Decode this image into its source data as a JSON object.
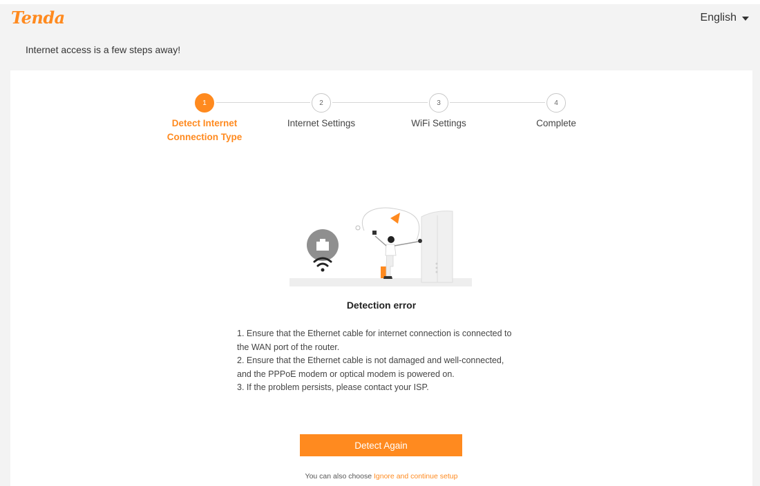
{
  "header": {
    "brand": "Tenda",
    "language": "English"
  },
  "subtitle": "Internet access is a few steps away!",
  "steps": [
    {
      "number": "1",
      "label": "Detect Internet Connection Type",
      "active": true
    },
    {
      "number": "2",
      "label": "Internet Settings",
      "active": false
    },
    {
      "number": "3",
      "label": "WiFi Settings",
      "active": false
    },
    {
      "number": "4",
      "label": "Complete",
      "active": false
    }
  ],
  "error": {
    "title": "Detection error",
    "lines": [
      "1. Ensure that the Ethernet cable for internet connection is connected to the WAN port of the router.",
      "2. Ensure that the Ethernet cable is not damaged and well-connected, and the PPPoE modem or optical modem is powered on.",
      "3. If the problem persists, please contact your ISP."
    ]
  },
  "actions": {
    "detect_again": "Detect Again",
    "alt_prefix": "You can also choose",
    "alt_link": "Ignore and continue setup"
  },
  "colors": {
    "accent": "#ff8a1f",
    "background": "#f3f3f3",
    "card": "#ffffff"
  },
  "icons": [
    "caret-down-icon",
    "ethernet-port-icon",
    "wifi-icon",
    "router-icon",
    "person-illustration",
    "warning-triangle-icon"
  ]
}
